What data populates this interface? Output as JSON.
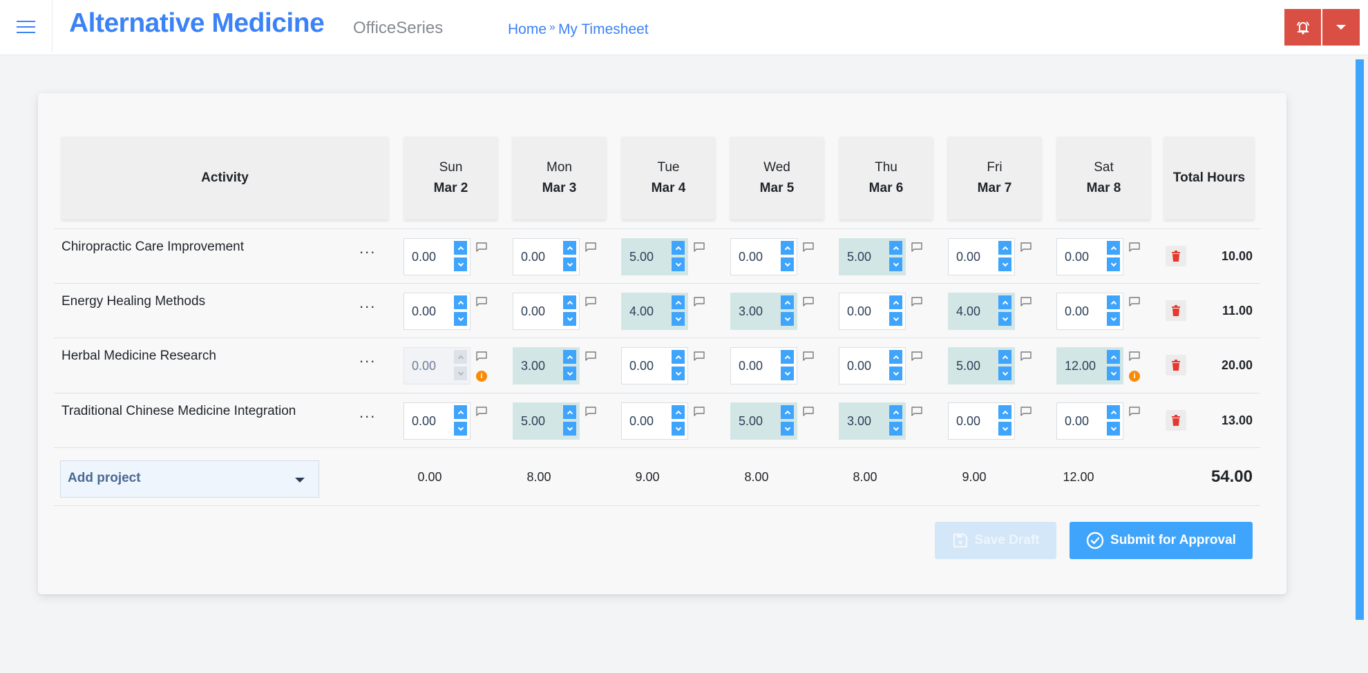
{
  "header": {
    "app_title": "Alternative Medicine",
    "app_subtitle": "OfficeSeries",
    "breadcrumb": [
      {
        "label": "Home"
      },
      {
        "label": "My Timesheet"
      }
    ],
    "breadcrumb_separator": "»",
    "icons": {
      "menu": "hamburger-menu-icon",
      "alerts": "bell-ringing-icon",
      "dropdown": "caret-down-icon"
    },
    "colors": {
      "brand": "#3b82f6",
      "alert_button": "#d94f43"
    }
  },
  "timesheet": {
    "columns": {
      "activity": "Activity",
      "total": "Total Hours",
      "days": [
        {
          "day": "Sun",
          "date": "Mar 2"
        },
        {
          "day": "Mon",
          "date": "Mar 3"
        },
        {
          "day": "Tue",
          "date": "Mar 4"
        },
        {
          "day": "Wed",
          "date": "Mar 5"
        },
        {
          "day": "Thu",
          "date": "Mar 6"
        },
        {
          "day": "Fri",
          "date": "Mar 7"
        },
        {
          "day": "Sat",
          "date": "Mar 8"
        }
      ]
    },
    "rows": [
      {
        "activity": "Chiropractic Care Improvement",
        "more_label": "...",
        "hours": [
          "0.00",
          "0.00",
          "5.00",
          "0.00",
          "5.00",
          "0.00",
          "0.00"
        ],
        "warnings": [
          false,
          false,
          false,
          false,
          false,
          false,
          false
        ],
        "disabled": [
          false,
          false,
          false,
          false,
          false,
          false,
          false
        ],
        "total": "10.00"
      },
      {
        "activity": "Energy Healing Methods",
        "more_label": "...",
        "hours": [
          "0.00",
          "0.00",
          "4.00",
          "3.00",
          "0.00",
          "4.00",
          "0.00"
        ],
        "warnings": [
          false,
          false,
          false,
          false,
          false,
          false,
          false
        ],
        "disabled": [
          false,
          false,
          false,
          false,
          false,
          false,
          false
        ],
        "total": "11.00"
      },
      {
        "activity": "Herbal Medicine Research",
        "more_label": "...",
        "hours": [
          "0.00",
          "3.00",
          "0.00",
          "0.00",
          "0.00",
          "5.00",
          "12.00"
        ],
        "warnings": [
          true,
          false,
          false,
          false,
          false,
          false,
          true
        ],
        "disabled": [
          true,
          false,
          false,
          false,
          false,
          false,
          false
        ],
        "total": "20.00"
      },
      {
        "activity": "Traditional Chinese Medicine Integration",
        "more_label": "...",
        "hours": [
          "0.00",
          "5.00",
          "0.00",
          "5.00",
          "3.00",
          "0.00",
          "0.00"
        ],
        "warnings": [
          false,
          false,
          false,
          false,
          false,
          false,
          false
        ],
        "disabled": [
          false,
          false,
          false,
          false,
          false,
          false,
          false
        ],
        "total": "13.00"
      }
    ],
    "add_project_label": "Add project",
    "day_totals": [
      "0.00",
      "8.00",
      "9.00",
      "8.00",
      "8.00",
      "9.00",
      "12.00"
    ],
    "grand_total": "54.00",
    "icons": {
      "comment": "comment-icon",
      "warning": "info-warning-icon",
      "delete": "trash-icon",
      "spin_up": "chevron-up-icon",
      "spin_down": "chevron-down-icon"
    },
    "colors": {
      "filled_cell": "#d3e6e6",
      "spinner_button": "#3fa4fb",
      "warning": "#f98a06",
      "delete": "#e8372c"
    }
  },
  "actions": {
    "save_draft_label": "Save Draft",
    "save_draft_enabled": false,
    "submit_label": "Submit for Approval",
    "submit_enabled": true
  }
}
